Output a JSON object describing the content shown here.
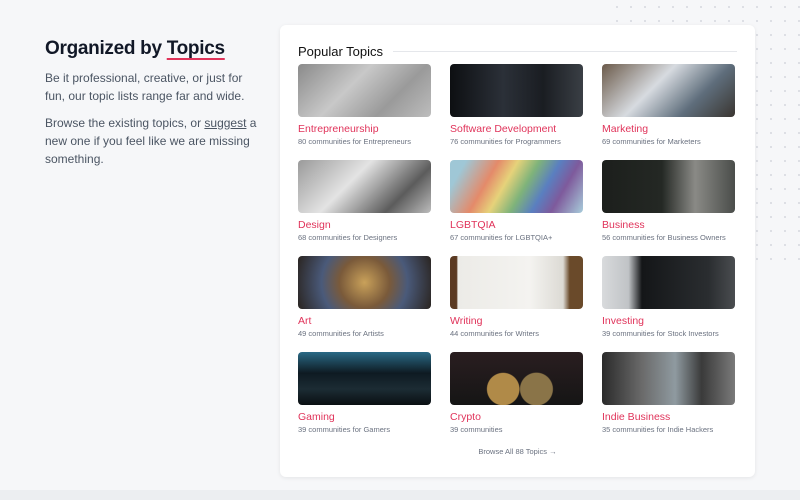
{
  "intro": {
    "title_prefix": "Organized by ",
    "title_highlight": "Topics",
    "p1": "Be it professional, creative, or just for fun, our topic lists range far and wide.",
    "p2_before": "Browse the existing topics, or ",
    "p2_link": "suggest",
    "p2_after": " a new one if you feel like we are missing something."
  },
  "panel": {
    "title": "Popular Topics",
    "browse_all": "Browse All 88 Topics →",
    "topics": [
      {
        "name": "Entrepreneurship",
        "count": "80 communities for Entrepreneurs",
        "bg": "linear-gradient(135deg,#8a8a8a,#c8c8c8 40%,#9a9a9a 70%,#bdbdbd)"
      },
      {
        "name": "Software Development",
        "count": "76 communities for Programmers",
        "bg": "linear-gradient(90deg,#0d0f12,#2b3038 40%,#1a1d22 70%,#3a3f45)"
      },
      {
        "name": "Marketing",
        "count": "69 communities for Marketers",
        "bg": "linear-gradient(135deg,#6b5a4a,#d7dbe0 40%,#5f6e7c 70%,#3a3530)"
      },
      {
        "name": "Design",
        "count": "68 communities for Designers",
        "bg": "linear-gradient(135deg,#9a9a9a,#e3e3e3 40%,#5c5c5c 75%,#bcbcbc)"
      },
      {
        "name": "LGBTQIA",
        "count": "67 communities for LGBTQIA+",
        "bg": "linear-gradient(120deg,#9fc7d6 10%,#e48a6a 30%,#e6d27a 42%,#7fb37a 55%,#5a7fc0 68%,#7e5a9c 80%,#a8cddb)"
      },
      {
        "name": "Business",
        "count": "56 communities for Business Owners",
        "bg": "linear-gradient(90deg,#1c1f1c,#242824 45%,#8a8a86 70%,#4a4d4a)"
      },
      {
        "name": "Art",
        "count": "49 communities for Artists",
        "bg": "radial-gradient(circle at 50% 50%,#c9a15a,#7a5a3a 35%,#4a5a7a 60%,#2a2420)"
      },
      {
        "name": "Writing",
        "count": "44 communities for Writers",
        "bg": "linear-gradient(90deg,#5b3a22 0 5%,#ecebe7 6%,#f4f3f0 60%,#dcdad4 85%,#6a4a2a 90%)"
      },
      {
        "name": "Investing",
        "count": "39 communities for Stock Investors",
        "bg": "linear-gradient(90deg,#d8dadc,#c0c3c6 20%,#141618 30%,#2a2d30 80%,#4a4d50)"
      },
      {
        "name": "Gaming",
        "count": "39 communities for Gamers",
        "bg": "linear-gradient(180deg,#2a6a86,#0e1a22 40%,#1c2c34 70%,#0a0f12)"
      },
      {
        "name": "Crypto",
        "count": "39 communities",
        "bg": "radial-gradient(circle at 40% 70%,#b08a48 0 18%,transparent 19%),radial-gradient(circle at 65% 70%,#8a7448 0 17%,transparent 18%),linear-gradient(180deg,#2a1e20,#151515)"
      },
      {
        "name": "Indie Business",
        "count": "35 communities for Indie Hackers",
        "bg": "linear-gradient(90deg,#2a2a2a,#6a6a6a 30%,#8f9aa0 55%,#3a3a3a 75%,#7a7a7a)"
      }
    ]
  }
}
